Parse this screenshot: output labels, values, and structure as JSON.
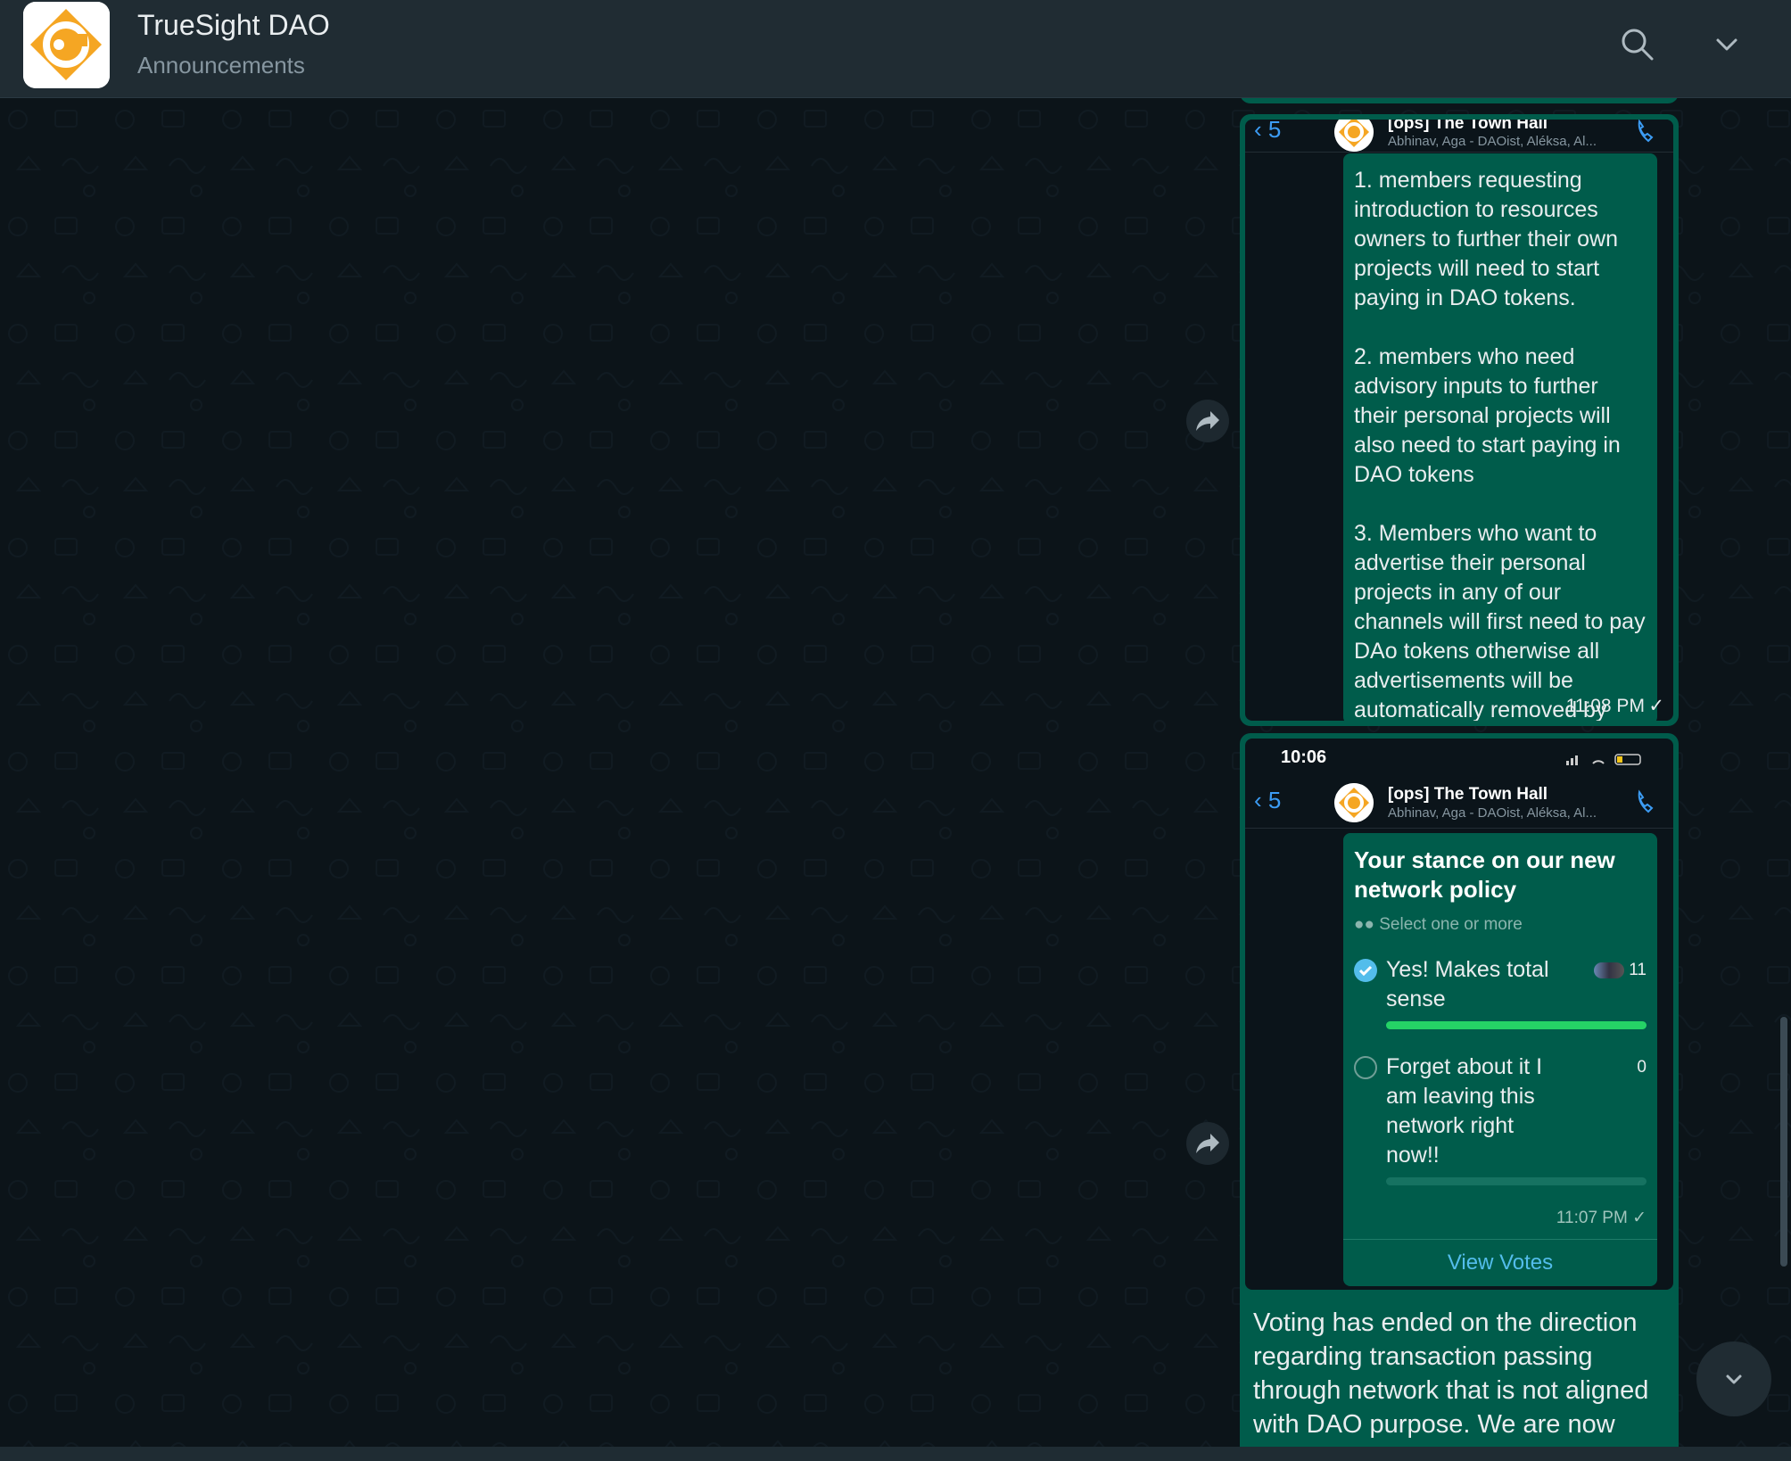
{
  "header": {
    "title": "TrueSight DAO",
    "subtitle": "Announcements",
    "search_icon": "search-icon",
    "menu_icon": "chevron-down-icon"
  },
  "colors": {
    "header_bg": "#202c33",
    "chat_bg": "#0b141a",
    "outgoing_bubble": "#005c4b",
    "accent_blue": "#53bdeb",
    "poll_bar_fill": "#25d366",
    "brand_orange": "#f5a623"
  },
  "messages": [
    {
      "type": "image",
      "top_time_partial": "11:08 PM ✓",
      "screenshot": {
        "back_count": "5",
        "group_name": "[ops] The Town Hall",
        "members": "Abhinav, Aga - DAOist, Aléksa, Al...",
        "message_text": [
          "1. members requesting introduction to resources owners to further their own projects will need to start paying in DAO tokens.",
          "2. members who need advisory inputs to further their personal projects will also need to start paying in DAO tokens",
          "3. Members who want to advertise their personal projects in any of our channels will first need to pay DAo tokens otherwise all advertisements will be automatically removed by"
        ]
      },
      "time": "11:08 PM",
      "status": "✓"
    },
    {
      "type": "image",
      "screenshot": {
        "phone_time": "10:06",
        "back_count": "5",
        "group_name": "[ops] The Town Hall",
        "members": "Abhinav, Aga - DAOist, Aléksa, Al...",
        "poll": {
          "question": "Your stance on our new network policy",
          "select_hint": "Select one or more",
          "options": [
            {
              "label": "Yes! Makes total sense",
              "votes": "11",
              "share": 1.0,
              "checked": true
            },
            {
              "label": "Forget about it I am leaving this network right now!!",
              "votes": "0",
              "share": 0.0,
              "checked": false
            }
          ],
          "time": "11:07 PM ✓",
          "view_votes": "View Votes"
        }
      }
    },
    {
      "type": "text",
      "text": "Voting has ended on the direction regarding transaction passing through network that is not aligned with DAO purpose. We are now definitely..."
    }
  ],
  "controls": {
    "forward_icon": "forward-icon",
    "scroll_down_icon": "chevron-down-icon"
  }
}
